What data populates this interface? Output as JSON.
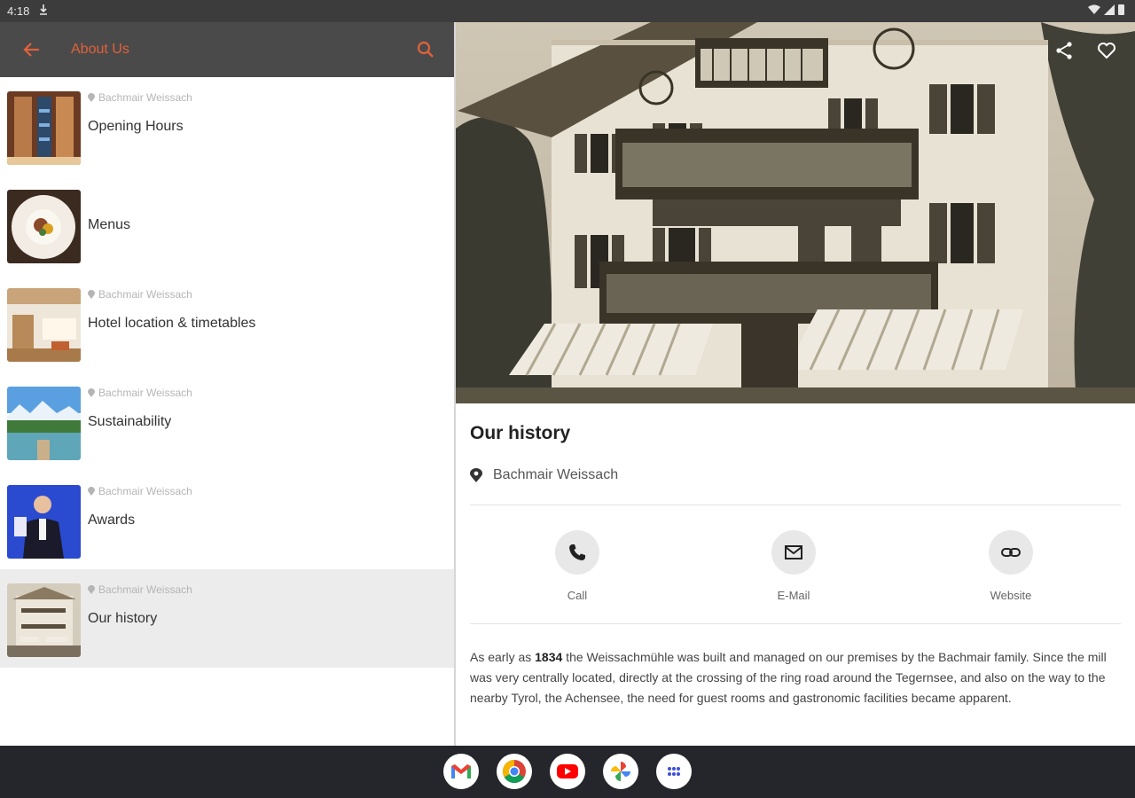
{
  "status_bar": {
    "time": "4:18",
    "download_icon": "download-icon",
    "wifi_icon": "wifi-icon",
    "signal_icon": "signal-icon",
    "battery_icon": "battery-icon"
  },
  "app_bar": {
    "title": "About Us",
    "back_icon": "back-arrow-icon",
    "search_icon": "search-icon",
    "accent": "#e0623c",
    "background": "#4a4a4a"
  },
  "list": {
    "items": [
      {
        "location": "Bachmair Weissach",
        "label": "Opening Hours",
        "thumb": "wine-cellar-image"
      },
      {
        "location": "",
        "label": "Menus",
        "thumb": "plated-dish-image"
      },
      {
        "location": "Bachmair Weissach",
        "label": "Hotel location & timetables",
        "thumb": "hotel-lobby-image"
      },
      {
        "location": "Bachmair Weissach",
        "label": "Sustainability",
        "thumb": "alpine-lake-image"
      },
      {
        "location": "Bachmair Weissach",
        "label": "Awards",
        "thumb": "award-ceremony-image"
      },
      {
        "location": "Bachmair Weissach",
        "label": "Our history",
        "thumb": "historic-building-image",
        "selected": true
      }
    ]
  },
  "detail": {
    "title": "Our history",
    "location": "Bachmair Weissach",
    "actions": [
      {
        "label": "Call",
        "icon": "phone-icon"
      },
      {
        "label": "E-Mail",
        "icon": "mail-icon"
      },
      {
        "label": "Website",
        "icon": "link-icon"
      }
    ],
    "description_pre": "As early as ",
    "description_bold": "1834",
    "description_post": " the Weissachmühle was built and managed on our premises by the Bachmair family. Since the mill was very centrally located, directly at the crossing of the ring road around the Tegernsee, and also on the way to the nearby Tyrol, the Achensee, the need for guest rooms and gastronomic facilities became apparent."
  },
  "dock": {
    "apps": [
      "gmail-icon",
      "chrome-icon",
      "youtube-icon",
      "photos-icon",
      "app-drawer-icon"
    ]
  }
}
